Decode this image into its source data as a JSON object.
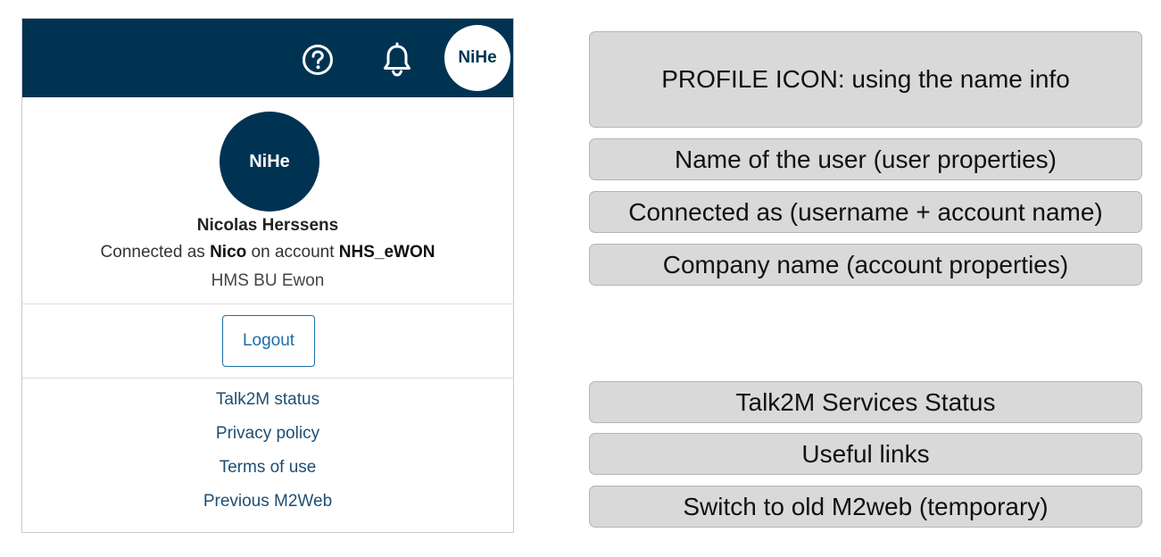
{
  "header": {
    "help_icon": "help-circle-icon",
    "notification_icon": "bell-icon",
    "avatar_initials": "NiHe",
    "background_color": "#003352"
  },
  "profile": {
    "avatar_initials": "NiHe",
    "name": "Nicolas Herssens",
    "connected_prefix": "Connected as",
    "username": "Nico",
    "connected_middle": "on account",
    "account": "NHS_eWON",
    "company": "HMS BU Ewon"
  },
  "logout_label": "Logout",
  "links": [
    {
      "label": "Talk2M status"
    },
    {
      "label": "Privacy policy"
    },
    {
      "label": "Terms of use"
    },
    {
      "label": "Previous M2Web"
    }
  ],
  "annotations": [
    {
      "text": "PROFILE ICON: using the name info"
    },
    {
      "text": "Name of the user (user properties)"
    },
    {
      "text": "Connected as (username + account name)"
    },
    {
      "text": "Company name (account properties)"
    },
    {
      "text": "Talk2M Services Status"
    },
    {
      "text": "Useful links"
    },
    {
      "text": "Switch to old M2web (temporary)"
    }
  ],
  "colors": {
    "brand_dark": "#003352",
    "link": "#1f4e72",
    "button_accent": "#1a6ea8",
    "annotation_bg": "#d9d9d9"
  }
}
